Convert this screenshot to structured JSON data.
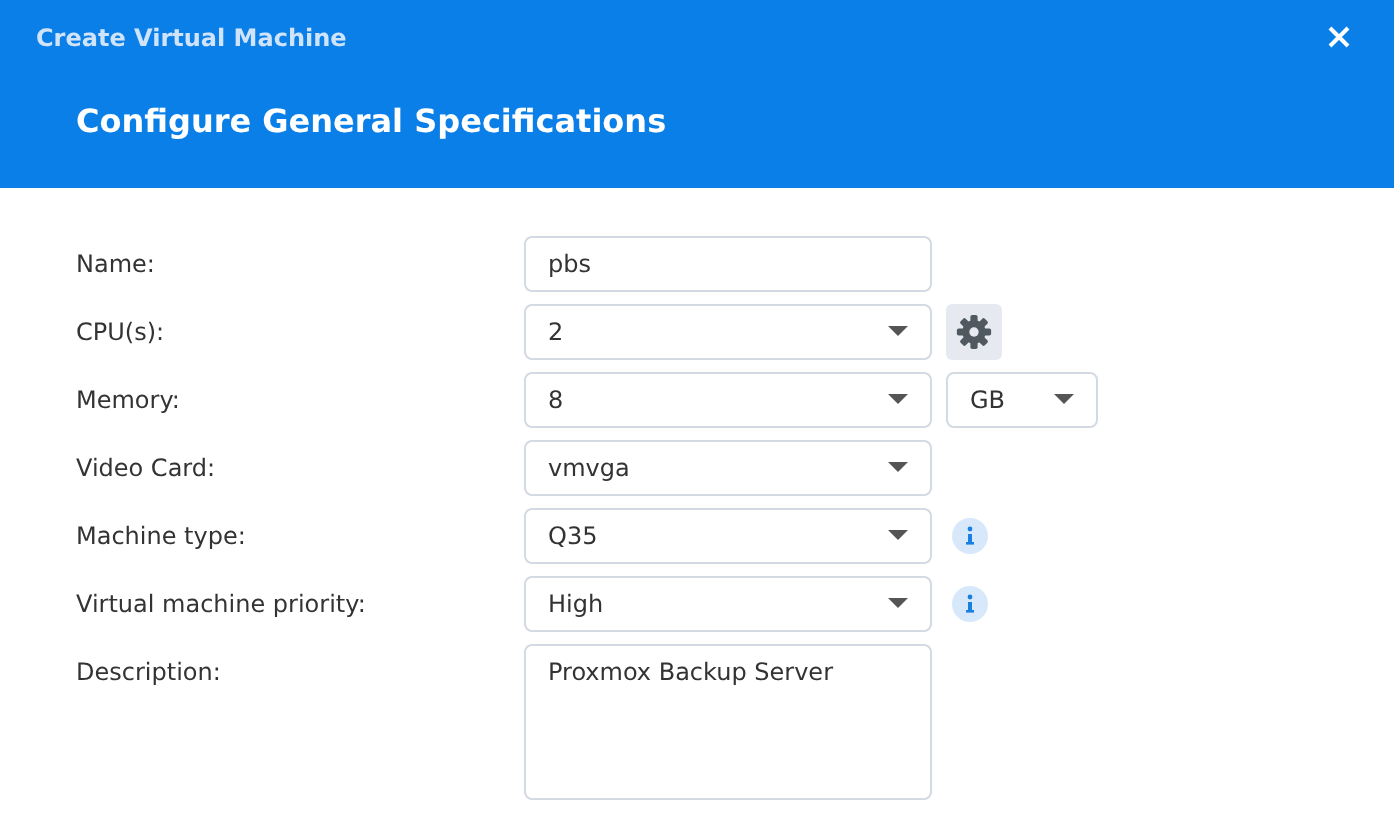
{
  "window": {
    "title": "Create Virtual Machine"
  },
  "heading": "Configure General Specifications",
  "fields": [
    {
      "label": "Name:",
      "kind": "text",
      "value": "pbs"
    },
    {
      "label": "CPU(s):",
      "kind": "select",
      "value": "2",
      "extra": {
        "kind": "gear"
      }
    },
    {
      "label": "Memory:",
      "kind": "select",
      "value": "8",
      "extra": {
        "kind": "unit",
        "value": "GB"
      }
    },
    {
      "label": "Video Card:",
      "kind": "select",
      "value": "vmvga"
    },
    {
      "label": "Machine type:",
      "kind": "select",
      "value": "Q35",
      "extra": {
        "kind": "info"
      }
    },
    {
      "label": "Virtual machine priority:",
      "kind": "select",
      "value": "High",
      "extra": {
        "kind": "info"
      }
    },
    {
      "label": "Description:",
      "kind": "textarea",
      "value": "Proxmox Backup Server"
    }
  ]
}
